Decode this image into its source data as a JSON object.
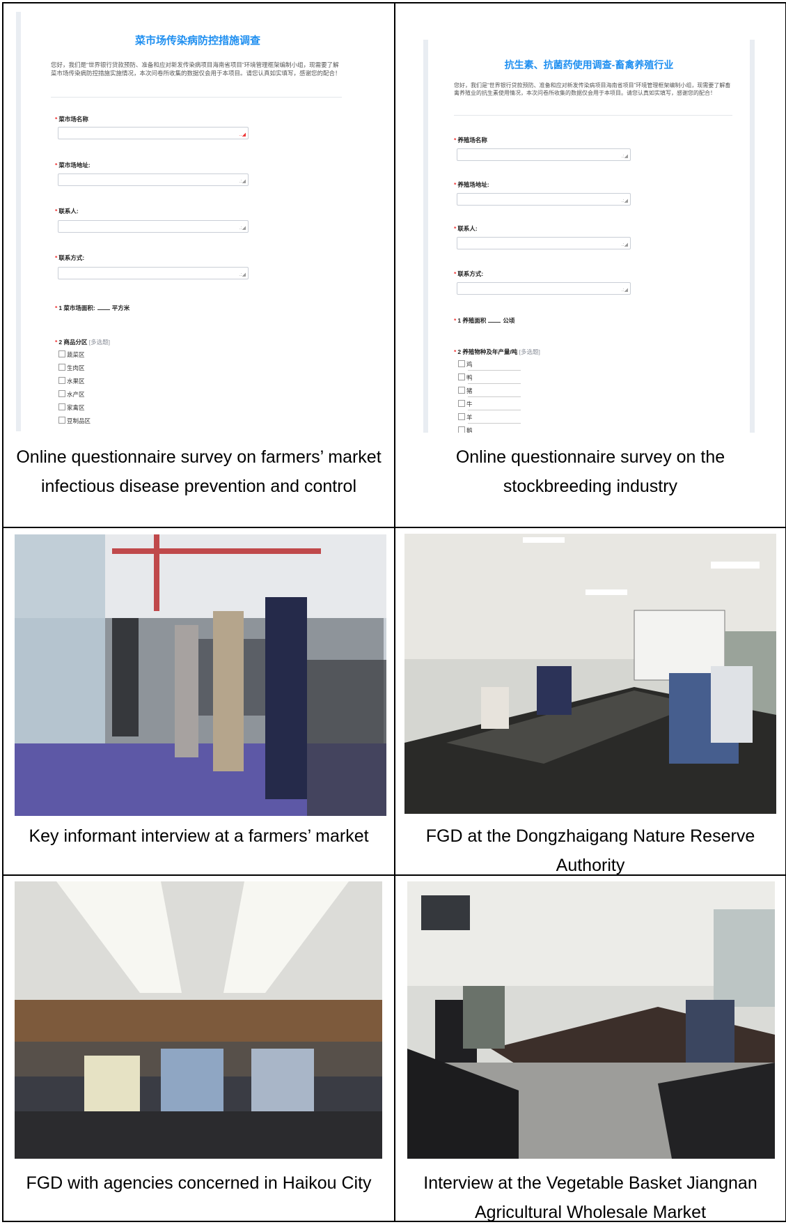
{
  "cells": [
    {
      "caption": "Online questionnaire survey on farmers’ market infectious disease prevention and control",
      "screenshot": {
        "title": "菜市场传染病防控措施调查",
        "intro": "您好，我们是“世界银行贷款预防、准备和应对新发传染病项目海南省项目”环境管理框架编制小组，现需要了解菜市场传染病防控措施实施情况，本次问卷所收集的数据仅会用于本项目。请您认真如实填写，感谢您的配合！",
        "fields": [
          "菜市场名称",
          "菜市场地址:",
          "联系人:",
          "联系方式:"
        ],
        "q1_label": "1 菜市场面积:",
        "q1_unit": "平方米",
        "q2_label": "2 商品分区",
        "q2_hint": "[多选题]",
        "q2_options": [
          "蔬菜区",
          "生肉区",
          "水果区",
          "水产区",
          "家禽区",
          "豆制品区"
        ]
      }
    },
    {
      "caption": "Online questionnaire survey on the stockbreeding industry",
      "screenshot": {
        "title": "抗生素、抗菌药使用调查-畜禽养殖行业",
        "intro": "您好，我们是“世界银行贷款预防、准备和应对新发传染病项目海南省项目”环境管理框架编制小组，现需要了解畜禽养殖业的抗生素使用情况，本次问卷所收集的数据仅会用于本项目。请您认真如实填写，感谢您的配合！",
        "fields": [
          "养殖场名称",
          "养殖场地址:",
          "联系人:",
          "联系方式:"
        ],
        "q1_label": "1 养殖面积",
        "q1_unit": "公顷",
        "q2_label": "2 养殖物种及年产量/吨",
        "q2_hint": "[多选题]",
        "q2_options": [
          "鸡",
          "鸭",
          "猪",
          "牛",
          "羊",
          "鹅"
        ]
      }
    },
    {
      "caption": "Key informant interview at a farmers’ market"
    },
    {
      "caption": "FGD at the Dongzhaigang Nature Reserve Authority"
    },
    {
      "caption": "FGD with agencies concerned in Haikou City"
    },
    {
      "caption": "Interview at the Vegetable Basket Jiangnan Agricultural Wholesale Market"
    }
  ]
}
